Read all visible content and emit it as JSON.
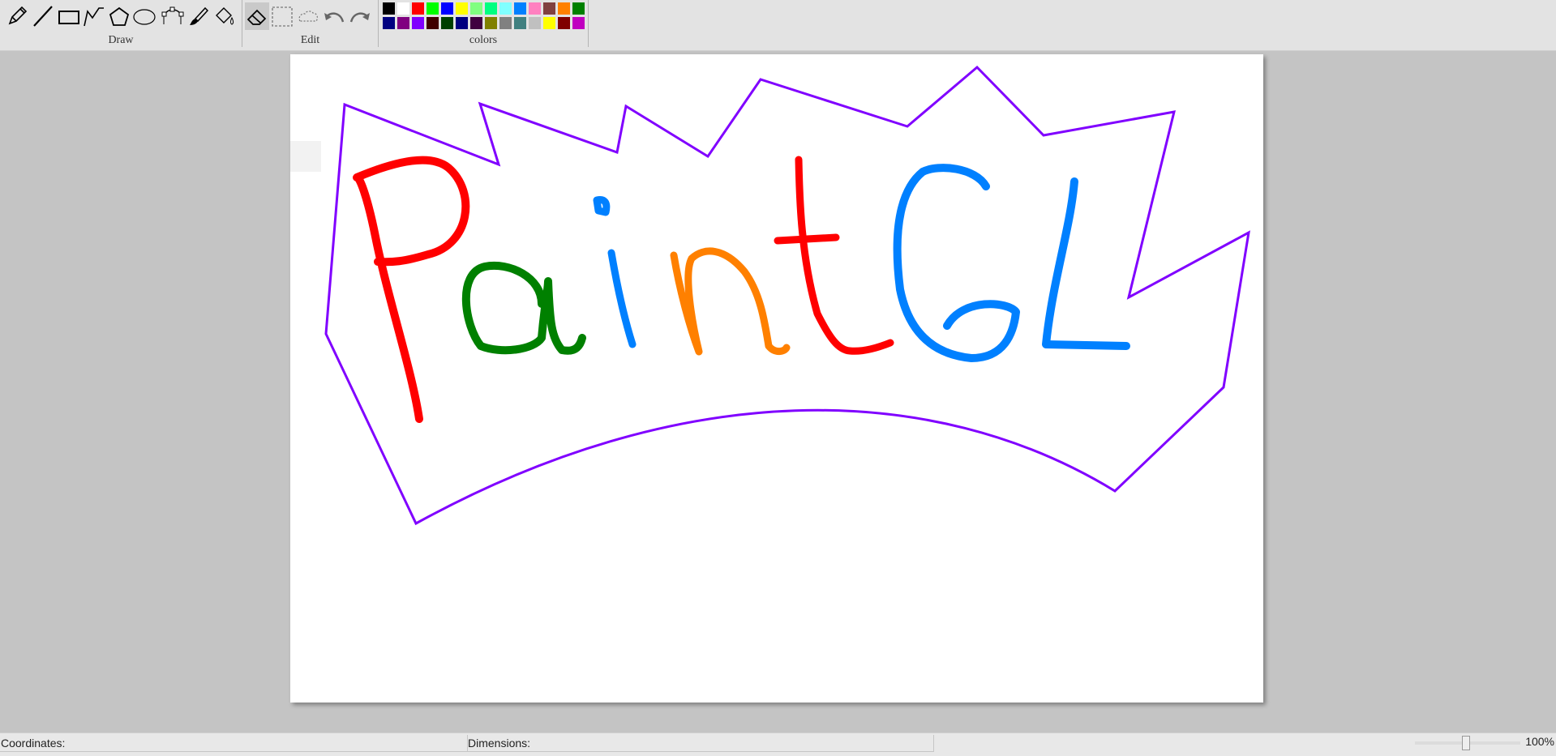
{
  "toolbar": {
    "groups": {
      "draw": "Draw",
      "edit": "Edit",
      "colors": "colors"
    },
    "draw_tools": [
      "pencil-icon",
      "line-icon",
      "rectangle-icon",
      "polyline-icon",
      "polygon-icon",
      "ellipse-icon",
      "bezier-icon",
      "brush-icon",
      "fill-bucket-icon"
    ],
    "edit_tools": [
      "eraser-icon",
      "rect-select-icon",
      "lasso-select-icon",
      "undo-icon",
      "redo-icon"
    ],
    "active_tool": "eraser",
    "palette_row1": [
      "#000000",
      "#ffffff",
      "#ff0000",
      "#00ff00",
      "#0000ff",
      "#ffff00",
      "#80ff80",
      "#00ff80",
      "#80ffff",
      "#0080ff",
      "#ff80c0",
      "#804040",
      "#ff8000",
      "#008000"
    ],
    "palette_row2": [
      "#000080",
      "#800080",
      "#8000ff",
      "#400000",
      "#004000",
      "#000080",
      "#400040",
      "#808000",
      "#808080",
      "#408080",
      "#c0c0c0",
      "#ffff00",
      "#800000",
      "#c000c0"
    ]
  },
  "canvas": {
    "drawing_text": "PaintGL",
    "stroke_colors": {
      "border": "#8000ff",
      "P": "#ff0000",
      "a": "#008000",
      "i": "#0080ff",
      "n": "#ff8000",
      "t": "#ff0000",
      "GL": "#0080ff"
    }
  },
  "statusbar": {
    "coordinates_label": "Coordinates:",
    "dimensions_label": "Dimensions:",
    "zoom": "100%"
  }
}
